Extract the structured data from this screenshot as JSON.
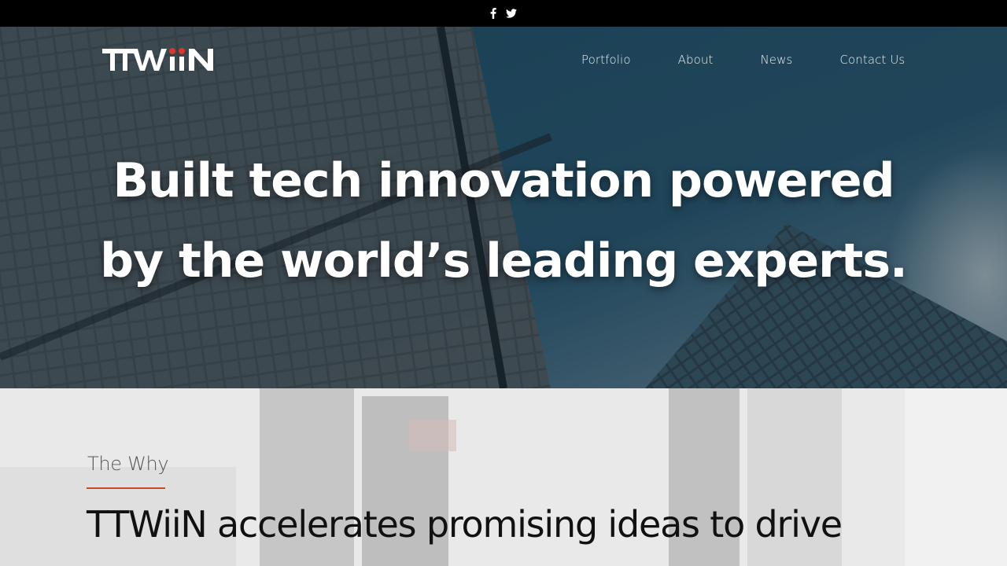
{
  "topbar": {
    "social_icons": [
      "facebook-icon",
      "twitter-icon"
    ]
  },
  "header": {
    "logo_text": "TTWiiN",
    "nav": [
      {
        "label": "Portfolio"
      },
      {
        "label": "About"
      },
      {
        "label": "News"
      },
      {
        "label": "Contact Us"
      }
    ]
  },
  "hero": {
    "headline_line1": "Built tech innovation powered",
    "headline_line2": "by the world’s leading experts."
  },
  "why": {
    "eyebrow": "The Why",
    "statement": "TTWiiN accelerates promising ideas to drive"
  },
  "colors": {
    "topbar_bg": "#000000",
    "accent": "#c9472a",
    "logo_dot": "#d9382a"
  }
}
